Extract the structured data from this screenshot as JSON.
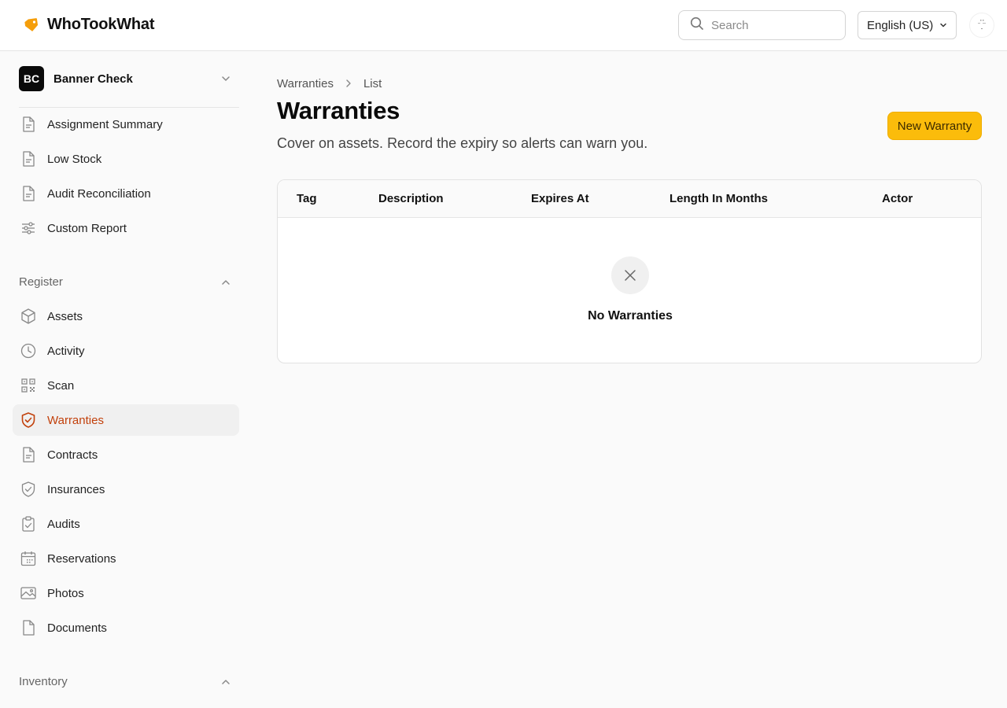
{
  "app": {
    "name": "WhoTookWhat"
  },
  "header": {
    "search_placeholder": "Search",
    "language": "English (US)"
  },
  "workspace": {
    "initials": "BC",
    "name": "Banner Check"
  },
  "sidebar": {
    "reports": [
      {
        "label": "Assignment Summary",
        "icon": "document-icon"
      },
      {
        "label": "Low Stock",
        "icon": "document-icon"
      },
      {
        "label": "Audit Reconciliation",
        "icon": "document-icon"
      },
      {
        "label": "Custom Report",
        "icon": "sliders-icon"
      }
    ],
    "register_section": "Register",
    "register": [
      {
        "label": "Assets",
        "icon": "cube-icon"
      },
      {
        "label": "Activity",
        "icon": "clock-icon"
      },
      {
        "label": "Scan",
        "icon": "qr-code-icon"
      },
      {
        "label": "Warranties",
        "icon": "shield-check-icon",
        "active": true
      },
      {
        "label": "Contracts",
        "icon": "document-icon"
      },
      {
        "label": "Insurances",
        "icon": "shield-check-icon"
      },
      {
        "label": "Audits",
        "icon": "clipboard-check-icon"
      },
      {
        "label": "Reservations",
        "icon": "calendar-icon"
      },
      {
        "label": "Photos",
        "icon": "image-icon"
      },
      {
        "label": "Documents",
        "icon": "file-icon"
      }
    ],
    "inventory_section": "Inventory"
  },
  "breadcrumb": {
    "parent": "Warranties",
    "current": "List"
  },
  "page": {
    "title": "Warranties",
    "subtitle": "Cover on assets. Record the expiry so alerts can warn you.",
    "new_button": "New Warranty"
  },
  "table": {
    "columns": [
      "Tag",
      "Description",
      "Expires At",
      "Length In Months",
      "Actor"
    ],
    "empty_text": "No Warranties"
  },
  "colors": {
    "accent": "#fbbc0b",
    "active_text": "#c2410c",
    "logo": "#f59e0b"
  }
}
